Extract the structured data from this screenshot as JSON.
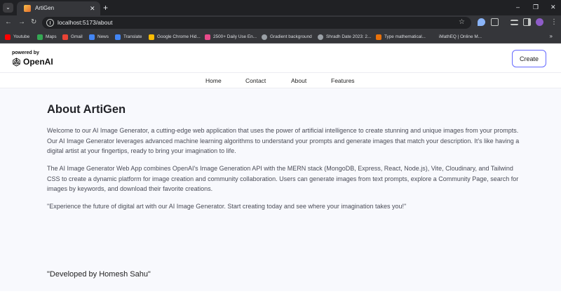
{
  "browser": {
    "tab": {
      "title": "ArtiGen",
      "close": "✕"
    },
    "tab_list_icon": "⌄",
    "new_tab": "+",
    "window_controls": {
      "minimize": "–",
      "restore": "❐",
      "close": "✕"
    },
    "nav": {
      "back": "←",
      "forward": "→",
      "reload": "↻"
    },
    "url": "localhost:5173/about",
    "bookmarks": [
      {
        "label": "Youtube",
        "color": "#ff0000"
      },
      {
        "label": "Maps",
        "color": "#34a853"
      },
      {
        "label": "Gmail",
        "color": "#ea4335"
      },
      {
        "label": "News",
        "color": "#4285f4"
      },
      {
        "label": "Translate",
        "color": "#4285f4"
      },
      {
        "label": "Google Chrome Hid...",
        "color": "#fbbc04"
      },
      {
        "label": "2500+ Daily Use En...",
        "color": "#e84a8a"
      },
      {
        "label": "Gradient background",
        "color": "#9aa0a6"
      },
      {
        "label": "Shradh Date 2023: 2...",
        "color": "#9aa0a6"
      },
      {
        "label": "Type mathematical...",
        "color": "#e8710a"
      },
      {
        "label": "iMathEQ | Online M...",
        "color": "#35363a"
      }
    ],
    "bookmarks_more": "»"
  },
  "header": {
    "powered_by": "powered by",
    "brand": "OpenAI",
    "create_label": "Create",
    "accent_color": "#6469ff"
  },
  "nav": {
    "links": [
      "Home",
      "Contact",
      "About",
      "Features"
    ]
  },
  "about": {
    "title": "About ArtiGen",
    "paragraphs": [
      "Welcome to our AI Image Generator, a cutting-edge web application that uses the power of artificial intelligence to create stunning and unique images from your prompts. Our AI Image Generator leverages advanced machine learning algorithms to understand your prompts and generate images that match your description. It’s like having a digital artist at your fingertips, ready to bring your imagination to life.",
      "The AI Image Generator Web App combines OpenAI's Image Generation API with the MERN stack (MongoDB, Express, React, Node.js), Vite, Cloudinary, and Tailwind CSS to create a dynamic platform for image creation and community collaboration. Users can generate images from text prompts, explore a Community Page, search for images by keywords, and download their favorite creations.",
      "\"Experience the future of digital art with our AI Image Generator. Start creating today and see where your imagination takes you!\""
    ],
    "developer": "\"Developed by Homesh Sahu\""
  }
}
